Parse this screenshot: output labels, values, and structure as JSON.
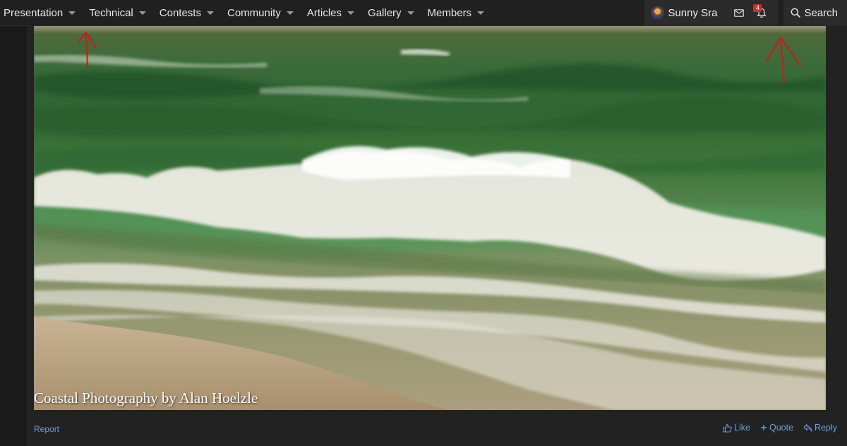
{
  "nav": {
    "items": [
      {
        "label": "Presentation"
      },
      {
        "label": "Technical"
      },
      {
        "label": "Contests"
      },
      {
        "label": "Community"
      },
      {
        "label": "Articles"
      },
      {
        "label": "Gallery"
      },
      {
        "label": "Members"
      }
    ],
    "user_name": "Sunny Sra",
    "alerts_count": "4",
    "search_label": "Search"
  },
  "post": {
    "caption": "Coastal Photography by Alan Hoelzle",
    "report_label": "Report",
    "like_label": "Like",
    "quote_label": "Quote",
    "reply_label": "Reply"
  },
  "colors": {
    "link": "#6f9fd6",
    "annotation_arrows": "#d01818",
    "badge": "#c53030"
  }
}
